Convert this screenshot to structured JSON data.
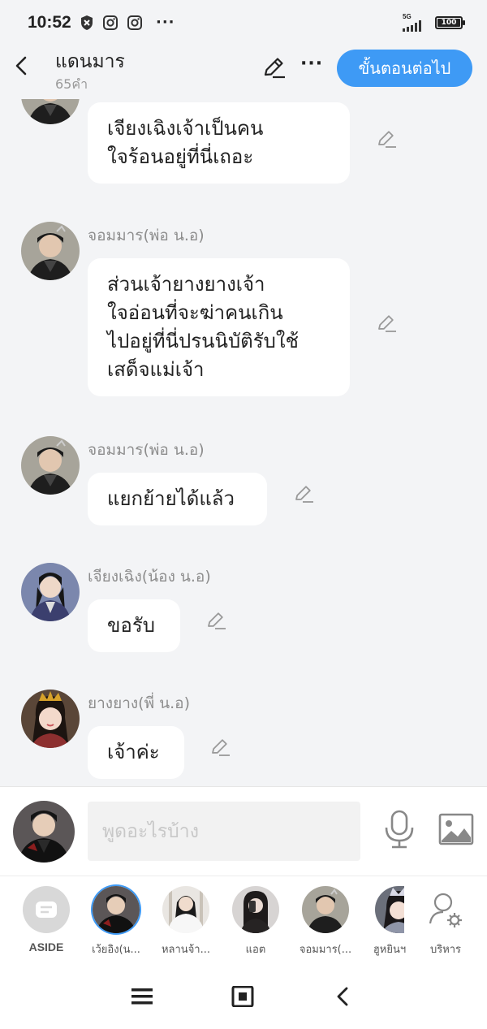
{
  "status_bar": {
    "time": "10:52",
    "network": "5G",
    "battery": "100"
  },
  "header": {
    "title": "แดนมาร",
    "subtitle": "65คำ",
    "next_button": "ขั้นตอนต่อไป"
  },
  "messages": [
    {
      "sender": "",
      "lines": [
        "เจียงเฉิงเจ้าเป็นคน",
        "ใจร้อนอยู่ที่นี่เถอะ"
      ]
    },
    {
      "sender": "จอมมาร(พ่อ น.อ)",
      "lines": [
        "ส่วนเจ้ายางยางเจ้า",
        "ใจอ่อนที่จะฆ่าคนเกิน",
        "ไปอยู่ที่นี่ปรนนิบัติรับใช้",
        "เสด็จแม่เจ้า"
      ]
    },
    {
      "sender": "จอมมาร(พ่อ น.อ)",
      "lines": [
        "แยกย้ายได้แล้ว"
      ]
    },
    {
      "sender": "เจียงเฉิง(น้อง น.อ)",
      "lines": [
        "ขอรับ"
      ]
    },
    {
      "sender": "ยางยาง(พี่ น.อ)",
      "lines": [
        "เจ้าค่ะ"
      ]
    }
  ],
  "input": {
    "placeholder": "พูดอะไรบ้าง"
  },
  "characters": [
    {
      "name": "ASIDE"
    },
    {
      "name": "เว้ยอิง(น..."
    },
    {
      "name": "หลานจ้า..."
    },
    {
      "name": "แอต"
    },
    {
      "name": "จอมมาร(..."
    },
    {
      "name": "ฮูหยินฯ"
    },
    {
      "name": "บริหาร"
    }
  ],
  "colors": {
    "accent": "#3e9af5",
    "background": "#f3f4f6"
  }
}
